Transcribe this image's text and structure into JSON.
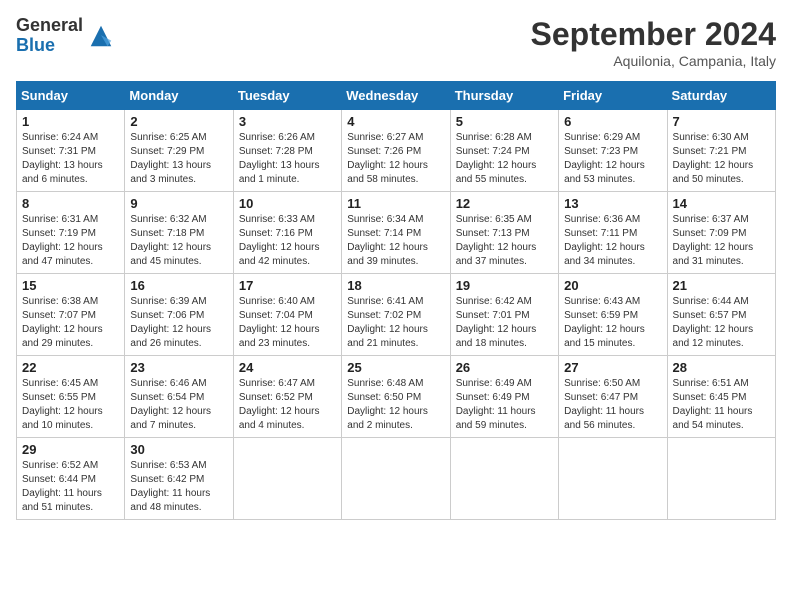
{
  "header": {
    "logo_general": "General",
    "logo_blue": "Blue",
    "month_title": "September 2024",
    "location": "Aquilonia, Campania, Italy"
  },
  "calendar": {
    "columns": [
      "Sunday",
      "Monday",
      "Tuesday",
      "Wednesday",
      "Thursday",
      "Friday",
      "Saturday"
    ],
    "weeks": [
      [
        {
          "day": "1",
          "sunrise": "Sunrise: 6:24 AM",
          "sunset": "Sunset: 7:31 PM",
          "daylight": "Daylight: 13 hours and 6 minutes."
        },
        {
          "day": "2",
          "sunrise": "Sunrise: 6:25 AM",
          "sunset": "Sunset: 7:29 PM",
          "daylight": "Daylight: 13 hours and 3 minutes."
        },
        {
          "day": "3",
          "sunrise": "Sunrise: 6:26 AM",
          "sunset": "Sunset: 7:28 PM",
          "daylight": "Daylight: 13 hours and 1 minute."
        },
        {
          "day": "4",
          "sunrise": "Sunrise: 6:27 AM",
          "sunset": "Sunset: 7:26 PM",
          "daylight": "Daylight: 12 hours and 58 minutes."
        },
        {
          "day": "5",
          "sunrise": "Sunrise: 6:28 AM",
          "sunset": "Sunset: 7:24 PM",
          "daylight": "Daylight: 12 hours and 55 minutes."
        },
        {
          "day": "6",
          "sunrise": "Sunrise: 6:29 AM",
          "sunset": "Sunset: 7:23 PM",
          "daylight": "Daylight: 12 hours and 53 minutes."
        },
        {
          "day": "7",
          "sunrise": "Sunrise: 6:30 AM",
          "sunset": "Sunset: 7:21 PM",
          "daylight": "Daylight: 12 hours and 50 minutes."
        }
      ],
      [
        {
          "day": "8",
          "sunrise": "Sunrise: 6:31 AM",
          "sunset": "Sunset: 7:19 PM",
          "daylight": "Daylight: 12 hours and 47 minutes."
        },
        {
          "day": "9",
          "sunrise": "Sunrise: 6:32 AM",
          "sunset": "Sunset: 7:18 PM",
          "daylight": "Daylight: 12 hours and 45 minutes."
        },
        {
          "day": "10",
          "sunrise": "Sunrise: 6:33 AM",
          "sunset": "Sunset: 7:16 PM",
          "daylight": "Daylight: 12 hours and 42 minutes."
        },
        {
          "day": "11",
          "sunrise": "Sunrise: 6:34 AM",
          "sunset": "Sunset: 7:14 PM",
          "daylight": "Daylight: 12 hours and 39 minutes."
        },
        {
          "day": "12",
          "sunrise": "Sunrise: 6:35 AM",
          "sunset": "Sunset: 7:13 PM",
          "daylight": "Daylight: 12 hours and 37 minutes."
        },
        {
          "day": "13",
          "sunrise": "Sunrise: 6:36 AM",
          "sunset": "Sunset: 7:11 PM",
          "daylight": "Daylight: 12 hours and 34 minutes."
        },
        {
          "day": "14",
          "sunrise": "Sunrise: 6:37 AM",
          "sunset": "Sunset: 7:09 PM",
          "daylight": "Daylight: 12 hours and 31 minutes."
        }
      ],
      [
        {
          "day": "15",
          "sunrise": "Sunrise: 6:38 AM",
          "sunset": "Sunset: 7:07 PM",
          "daylight": "Daylight: 12 hours and 29 minutes."
        },
        {
          "day": "16",
          "sunrise": "Sunrise: 6:39 AM",
          "sunset": "Sunset: 7:06 PM",
          "daylight": "Daylight: 12 hours and 26 minutes."
        },
        {
          "day": "17",
          "sunrise": "Sunrise: 6:40 AM",
          "sunset": "Sunset: 7:04 PM",
          "daylight": "Daylight: 12 hours and 23 minutes."
        },
        {
          "day": "18",
          "sunrise": "Sunrise: 6:41 AM",
          "sunset": "Sunset: 7:02 PM",
          "daylight": "Daylight: 12 hours and 21 minutes."
        },
        {
          "day": "19",
          "sunrise": "Sunrise: 6:42 AM",
          "sunset": "Sunset: 7:01 PM",
          "daylight": "Daylight: 12 hours and 18 minutes."
        },
        {
          "day": "20",
          "sunrise": "Sunrise: 6:43 AM",
          "sunset": "Sunset: 6:59 PM",
          "daylight": "Daylight: 12 hours and 15 minutes."
        },
        {
          "day": "21",
          "sunrise": "Sunrise: 6:44 AM",
          "sunset": "Sunset: 6:57 PM",
          "daylight": "Daylight: 12 hours and 12 minutes."
        }
      ],
      [
        {
          "day": "22",
          "sunrise": "Sunrise: 6:45 AM",
          "sunset": "Sunset: 6:55 PM",
          "daylight": "Daylight: 12 hours and 10 minutes."
        },
        {
          "day": "23",
          "sunrise": "Sunrise: 6:46 AM",
          "sunset": "Sunset: 6:54 PM",
          "daylight": "Daylight: 12 hours and 7 minutes."
        },
        {
          "day": "24",
          "sunrise": "Sunrise: 6:47 AM",
          "sunset": "Sunset: 6:52 PM",
          "daylight": "Daylight: 12 hours and 4 minutes."
        },
        {
          "day": "25",
          "sunrise": "Sunrise: 6:48 AM",
          "sunset": "Sunset: 6:50 PM",
          "daylight": "Daylight: 12 hours and 2 minutes."
        },
        {
          "day": "26",
          "sunrise": "Sunrise: 6:49 AM",
          "sunset": "Sunset: 6:49 PM",
          "daylight": "Daylight: 11 hours and 59 minutes."
        },
        {
          "day": "27",
          "sunrise": "Sunrise: 6:50 AM",
          "sunset": "Sunset: 6:47 PM",
          "daylight": "Daylight: 11 hours and 56 minutes."
        },
        {
          "day": "28",
          "sunrise": "Sunrise: 6:51 AM",
          "sunset": "Sunset: 6:45 PM",
          "daylight": "Daylight: 11 hours and 54 minutes."
        }
      ],
      [
        {
          "day": "29",
          "sunrise": "Sunrise: 6:52 AM",
          "sunset": "Sunset: 6:44 PM",
          "daylight": "Daylight: 11 hours and 51 minutes."
        },
        {
          "day": "30",
          "sunrise": "Sunrise: 6:53 AM",
          "sunset": "Sunset: 6:42 PM",
          "daylight": "Daylight: 11 hours and 48 minutes."
        },
        null,
        null,
        null,
        null,
        null
      ]
    ]
  }
}
